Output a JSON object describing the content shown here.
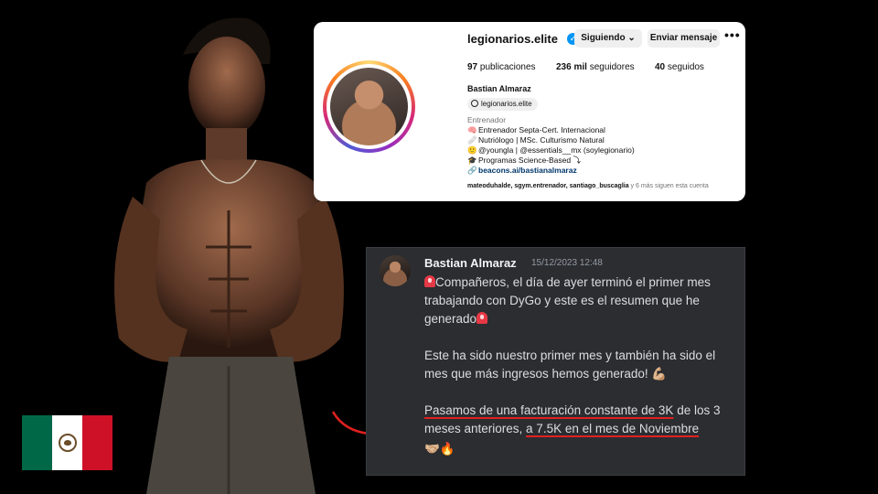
{
  "instagram": {
    "username": "legionarios.elite",
    "following_button": "Siguiendo ⌄",
    "message_button": "Enviar mensaje",
    "more_icon": "more-horizontal-icon",
    "stats": {
      "posts_count": "97",
      "posts_label": "publicaciones",
      "followers_count": "236 mil",
      "followers_label": "seguidores",
      "following_count": "40",
      "following_label": "seguidos"
    },
    "full_name": "Bastian Almaraz",
    "threads_handle": "legionarios.elite",
    "category": "Entrenador",
    "bio_lines": [
      {
        "icon": "🧠",
        "text": "Entrenador Septa-Cert. Internacional"
      },
      {
        "icon": "🩹",
        "text": "Nutriólogo | MSc. Culturismo Natural"
      },
      {
        "icon": "🙂",
        "text": "@youngla | @essentials__mx (soylegionario)"
      },
      {
        "icon": "🎓",
        "text": "Programas Science-Based ⤵"
      }
    ],
    "link": "beacons.ai/bastianalmaraz",
    "followed_by_names": "mateoduhalde, sgym.entrenador, santiago_buscaglia",
    "followed_by_rest": " y 6 más siguen esta cuenta"
  },
  "discord": {
    "author": "Bastian Almaraz",
    "timestamp": "15/12/2023 12:48",
    "p1_text": "Compañeros, el día de ayer terminó el primer mes trabajando con DyGo y este es el resumen que he generado",
    "p2_text": "Este ha sido nuestro primer mes y también ha sido el mes que más ingresos hemos generado! 💪🏼",
    "p3_part1": "Pasamos de una facturación constante de 3K",
    "p3_part2": " de los 3 meses anteriores, ",
    "p3_part3": "a 7.5K en el mes de Noviembre",
    "p4_text": "🤝🏼🔥"
  },
  "flag": {
    "name": "Mexico",
    "colors": [
      "#006847",
      "#ffffff",
      "#ce1126"
    ]
  },
  "colors": {
    "background": "#000000",
    "discord_bg": "#2b2d31",
    "verified_blue": "#0095f6",
    "underline_red": "#e02020"
  }
}
